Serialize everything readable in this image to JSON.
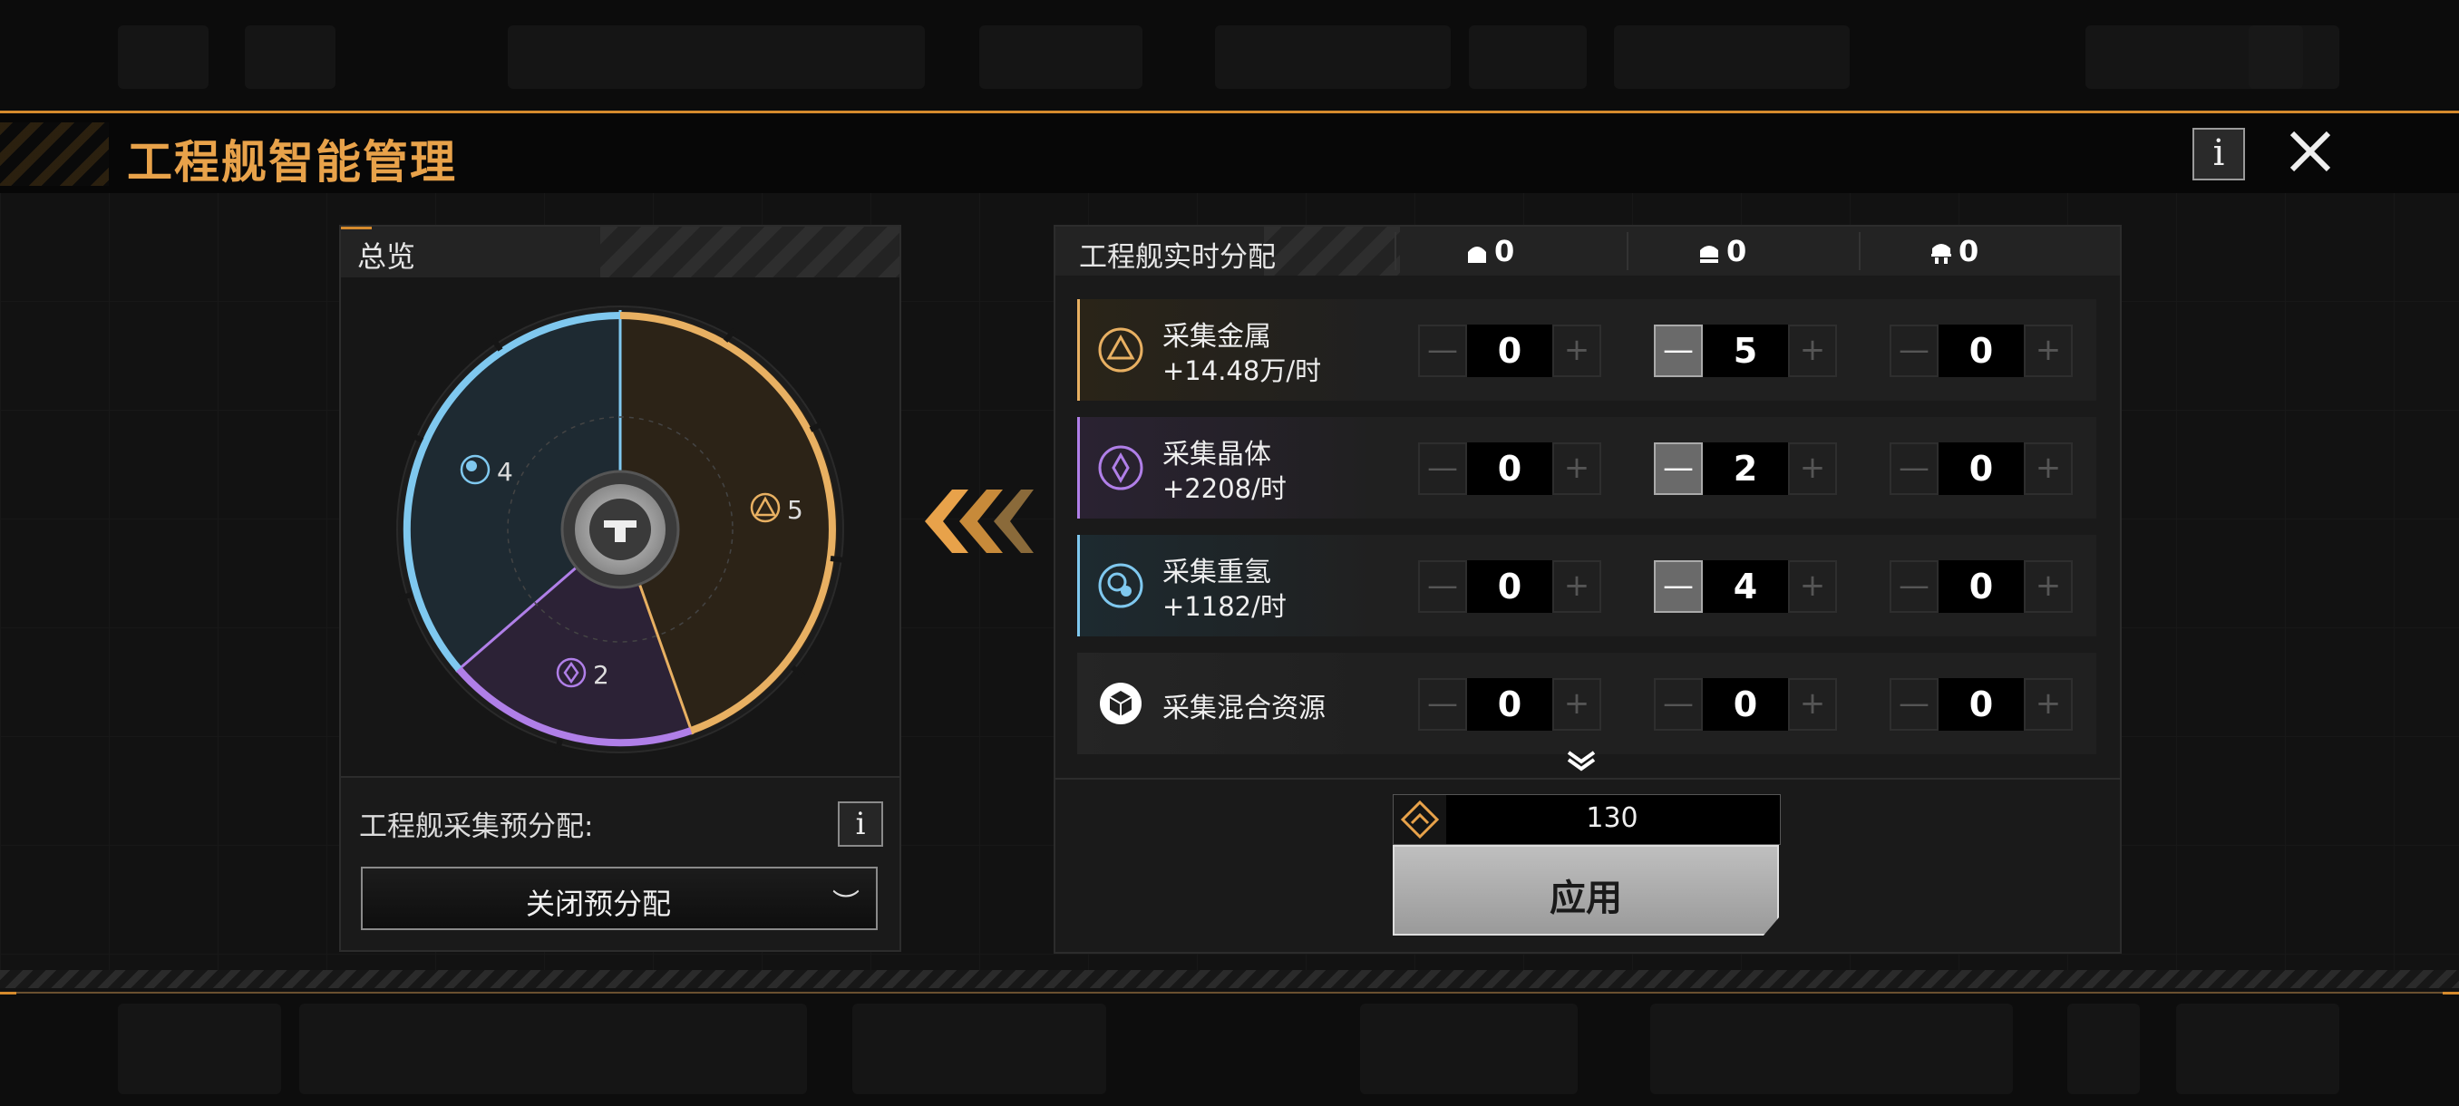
{
  "header": {
    "title": "工程舰智能管理",
    "info_label": "i",
    "close_label": "✕"
  },
  "overview": {
    "title": "总览",
    "segments": [
      {
        "resource": "heavy_hydrogen",
        "count": "4",
        "color": "#7fc8ef"
      },
      {
        "resource": "metal",
        "count": "5",
        "color": "#e8b062"
      },
      {
        "resource": "crystal",
        "count": "2",
        "color": "#b07fe8"
      }
    ]
  },
  "preallocation": {
    "label": "工程舰采集预分配:",
    "info_label": "i",
    "selected": "关闭预分配"
  },
  "realtime": {
    "title": "工程舰实时分配",
    "ship_columns": [
      {
        "icon": "ship-type-1-icon",
        "count": "0"
      },
      {
        "icon": "ship-type-2-icon",
        "count": "0"
      },
      {
        "icon": "ship-type-3-icon",
        "count": "0"
      }
    ],
    "rows": [
      {
        "name": "采集金属",
        "rate": "+14.48万/时",
        "icon": "metal-icon",
        "color": "#e8b062",
        "values": [
          "0",
          "5",
          "0"
        ]
      },
      {
        "name": "采集晶体",
        "rate": "+2208/时",
        "icon": "crystal-icon",
        "color": "#b07fe8",
        "values": [
          "0",
          "2",
          "0"
        ]
      },
      {
        "name": "采集重氢",
        "rate": "+1182/时",
        "icon": "heavy-hydrogen-icon",
        "color": "#7fc8ef",
        "values": [
          "0",
          "4",
          "0"
        ]
      },
      {
        "name": "采集混合资源",
        "rate": "",
        "icon": "mixed-resource-icon",
        "color": "#ffffff",
        "values": [
          "0",
          "0",
          "0"
        ]
      }
    ],
    "stepper_minus": "—",
    "stepper_plus": "+"
  },
  "apply": {
    "cost": "130",
    "label": "应用"
  },
  "colors": {
    "accent": "#e8a24a",
    "metal": "#e8b062",
    "crystal": "#b07fe8",
    "hydrogen": "#7fc8ef"
  }
}
